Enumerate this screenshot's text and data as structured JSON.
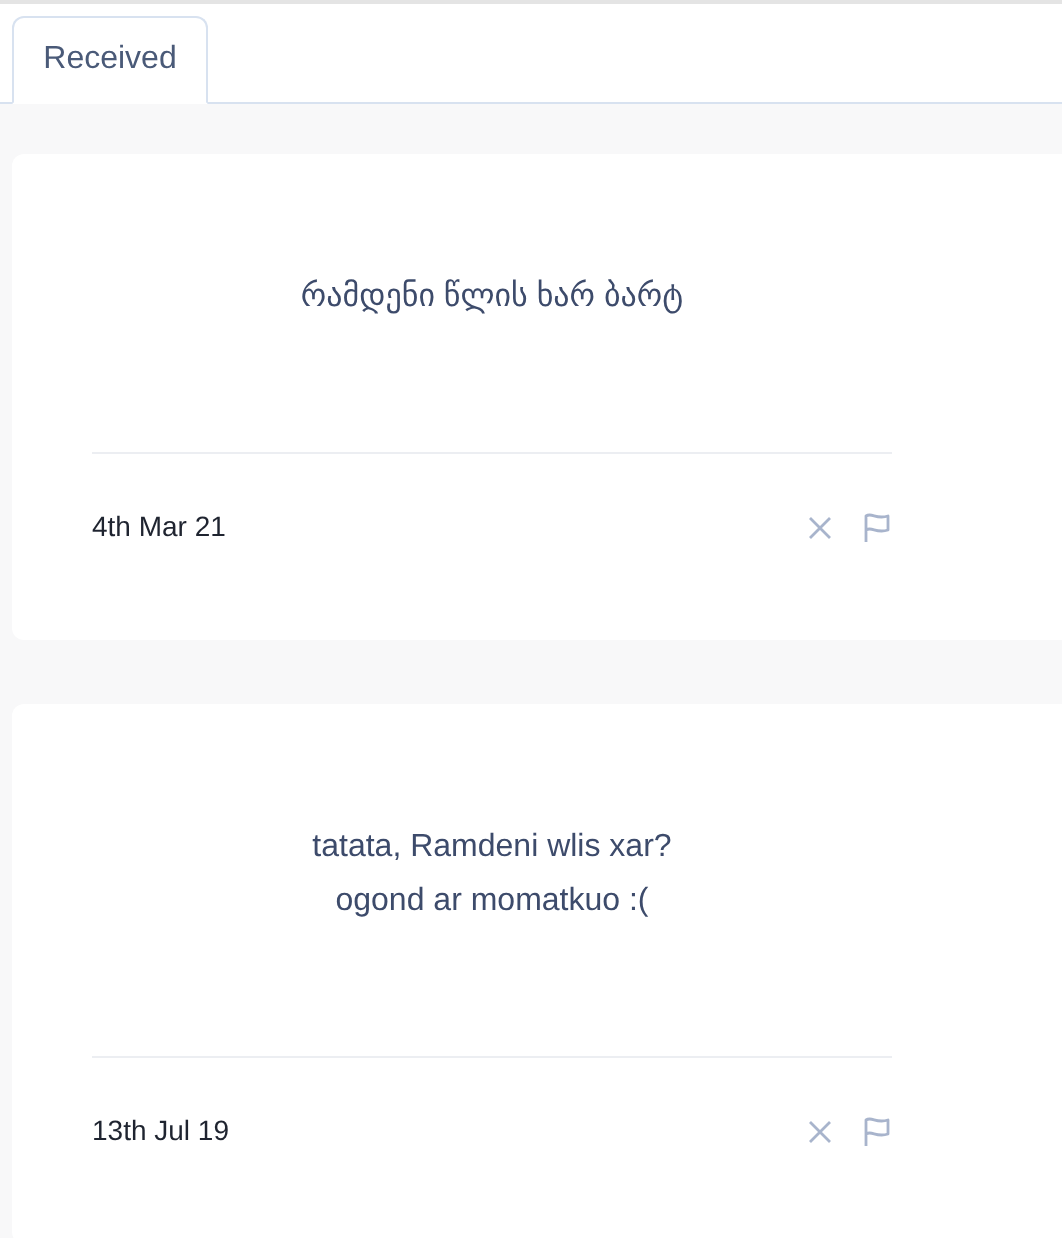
{
  "tabs": [
    {
      "label": "Received",
      "selected": true
    }
  ],
  "messages": [
    {
      "text": "რამდენი წლის ხარ ბარტ",
      "date": "4th Mar 21"
    },
    {
      "text": "tatata, Ramdeni wlis xar?\nogond ar momatkuo :(",
      "date": "13th Jul 19"
    }
  ]
}
